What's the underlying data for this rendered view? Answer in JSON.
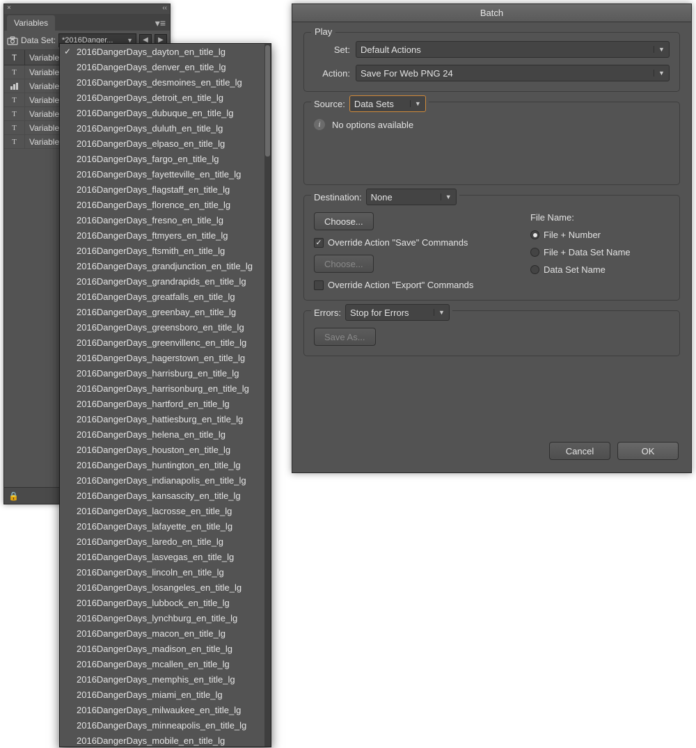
{
  "vars_panel": {
    "tab": "Variables",
    "dataset_label": "Data Set:",
    "dataset_value": "*2016Danger...",
    "col_icon": "T",
    "col_header": "Variable",
    "rows": [
      {
        "icon": "T",
        "name": "Variable"
      },
      {
        "icon": "bar",
        "name": "Variable"
      },
      {
        "icon": "T",
        "name": "Variable"
      },
      {
        "icon": "T",
        "name": "Variable"
      },
      {
        "icon": "T",
        "name": "Variable"
      },
      {
        "icon": "T",
        "name": "Variable"
      }
    ]
  },
  "dropdown": {
    "selected_index": 0,
    "items": [
      "2016DangerDays_dayton_en_title_lg",
      "2016DangerDays_denver_en_title_lg",
      "2016DangerDays_desmoines_en_title_lg",
      "2016DangerDays_detroit_en_title_lg",
      "2016DangerDays_dubuque_en_title_lg",
      "2016DangerDays_duluth_en_title_lg",
      "2016DangerDays_elpaso_en_title_lg",
      "2016DangerDays_fargo_en_title_lg",
      "2016DangerDays_fayetteville_en_title_lg",
      "2016DangerDays_flagstaff_en_title_lg",
      "2016DangerDays_florence_en_title_lg",
      "2016DangerDays_fresno_en_title_lg",
      "2016DangerDays_ftmyers_en_title_lg",
      "2016DangerDays_ftsmith_en_title_lg",
      "2016DangerDays_grandjunction_en_title_lg",
      "2016DangerDays_grandrapids_en_title_lg",
      "2016DangerDays_greatfalls_en_title_lg",
      "2016DangerDays_greenbay_en_title_lg",
      "2016DangerDays_greensboro_en_title_lg",
      "2016DangerDays_greenvillenc_en_title_lg",
      "2016DangerDays_hagerstown_en_title_lg",
      "2016DangerDays_harrisburg_en_title_lg",
      "2016DangerDays_harrisonburg_en_title_lg",
      "2016DangerDays_hartford_en_title_lg",
      "2016DangerDays_hattiesburg_en_title_lg",
      "2016DangerDays_helena_en_title_lg",
      "2016DangerDays_houston_en_title_lg",
      "2016DangerDays_huntington_en_title_lg",
      "2016DangerDays_indianapolis_en_title_lg",
      "2016DangerDays_kansascity_en_title_lg",
      "2016DangerDays_lacrosse_en_title_lg",
      "2016DangerDays_lafayette_en_title_lg",
      "2016DangerDays_laredo_en_title_lg",
      "2016DangerDays_lasvegas_en_title_lg",
      "2016DangerDays_lincoln_en_title_lg",
      "2016DangerDays_losangeles_en_title_lg",
      "2016DangerDays_lubbock_en_title_lg",
      "2016DangerDays_lynchburg_en_title_lg",
      "2016DangerDays_macon_en_title_lg",
      "2016DangerDays_madison_en_title_lg",
      "2016DangerDays_mcallen_en_title_lg",
      "2016DangerDays_memphis_en_title_lg",
      "2016DangerDays_miami_en_title_lg",
      "2016DangerDays_milwaukee_en_title_lg",
      "2016DangerDays_minneapolis_en_title_lg",
      "2016DangerDays_mobile_en_title_lg"
    ]
  },
  "batch": {
    "title": "Batch",
    "play": {
      "legend": "Play",
      "set_label": "Set:",
      "set_value": "Default Actions",
      "action_label": "Action:",
      "action_value": "Save For Web PNG 24"
    },
    "source": {
      "label": "Source:",
      "value": "Data Sets",
      "no_options": "No options available"
    },
    "destination": {
      "label": "Destination:",
      "value": "None",
      "choose": "Choose...",
      "override_save": "Override Action \"Save\" Commands",
      "override_save_checked": true,
      "choose2": "Choose...",
      "override_export": "Override Action \"Export\" Commands",
      "override_export_checked": false,
      "filename_label": "File Name:",
      "filename_options": [
        "File + Number",
        "File + Data Set Name",
        "Data Set Name"
      ],
      "filename_selected": 0
    },
    "errors": {
      "label": "Errors:",
      "value": "Stop for Errors",
      "save_as": "Save As..."
    },
    "cancel": "Cancel",
    "ok": "OK"
  }
}
